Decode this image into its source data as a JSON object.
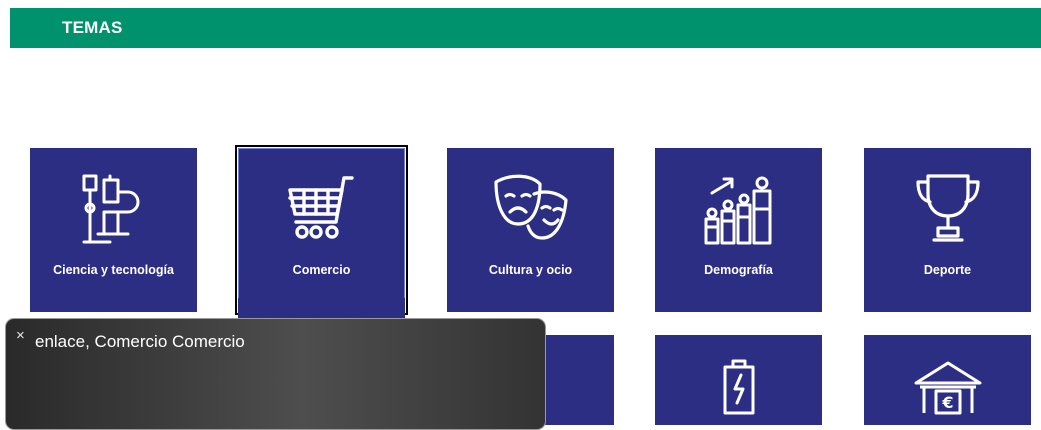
{
  "header": {
    "title": "TEMAS",
    "color": "#00926d"
  },
  "tile_color": "#2b2e83",
  "tiles": [
    {
      "label": "Ciencia y tecnología",
      "icon": "microscope-icon"
    },
    {
      "label": "Comercio",
      "icon": "shopping-cart-icon",
      "focused": true
    },
    {
      "label": "Cultura y ocio",
      "icon": "theater-masks-icon"
    },
    {
      "label": "Demografía",
      "icon": "population-chart-icon"
    },
    {
      "label": "Deporte",
      "icon": "trophy-icon"
    }
  ],
  "second_row": [
    {
      "icon": ""
    },
    {
      "icon": ""
    },
    {
      "icon": ""
    },
    {
      "icon": "battery-icon"
    },
    {
      "icon": "bank-euro-icon"
    }
  ],
  "screen_reader": {
    "text": "enlace, Comercio Comercio",
    "close": "×"
  }
}
